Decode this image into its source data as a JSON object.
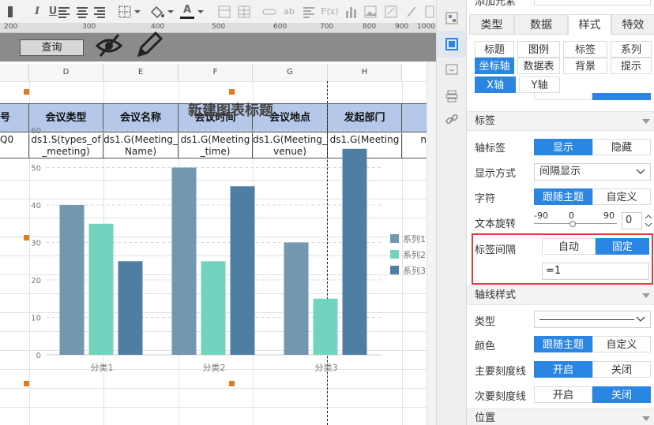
{
  "toolbar": {
    "italic": "I",
    "underline": "U",
    "font_color": "A",
    "fx": "F(x)",
    "ab": "ab"
  },
  "ruler": {
    "ticks": [
      "200",
      "300",
      "400",
      "500",
      "600",
      "700",
      "800",
      "900",
      "1000"
    ]
  },
  "mode_bar": {
    "query_label": "查询"
  },
  "sheet": {
    "columns": [
      "D",
      "E",
      "F",
      "G",
      "H"
    ],
    "header_partial_left": "号",
    "headers": [
      "会议类型",
      "会议名称",
      "会议时间",
      "会议地点",
      "发起部门"
    ],
    "data_partial_left": "Q0",
    "data_cells": [
      "ds1.S(types_of_meeting)",
      "ds1.G(Meeting_Name)",
      "ds1.G(Meeting_time)",
      "ds1.G(Meeting_venue)",
      "ds1.G(Meeting"
    ],
    "data_partial_right": "n"
  },
  "chart_data": {
    "type": "bar",
    "title": "新建图表标题",
    "categories": [
      "分类1",
      "分类2",
      "分类3"
    ],
    "series": [
      {
        "name": "系列1",
        "values": [
          40,
          50,
          30
        ],
        "color": "#7397b0"
      },
      {
        "name": "系列2",
        "values": [
          35,
          25,
          15
        ],
        "color": "#72d4be"
      },
      {
        "name": "系列3",
        "values": [
          25,
          45,
          55
        ],
        "color": "#4e7fa3"
      }
    ],
    "ylim": [
      0,
      60
    ],
    "yticks": [
      "0",
      "10",
      "20",
      "30",
      "40",
      "50",
      "60"
    ],
    "grid": true,
    "legend_position": "right"
  },
  "panel": {
    "top_partial": "添加元素",
    "tabs": [
      "类型",
      "数据",
      "样式",
      "特效"
    ],
    "active_tab": "样式",
    "subtabs_row1": [
      "标题",
      "图例",
      "标签",
      "系列"
    ],
    "subtabs_row2": [
      "坐标轴",
      "数据表",
      "背景",
      "提示"
    ],
    "axis_tabs": [
      "X轴",
      "Y轴"
    ],
    "section_label": "标签",
    "axis_label": "轴标签",
    "axis_label_options": [
      "显示",
      "隐藏"
    ],
    "display_mode_label": "显示方式",
    "display_mode_value": "间隔显示",
    "font_label": "字符",
    "font_options": [
      "跟随主题",
      "自定义"
    ],
    "rotation_label": "文本旋转",
    "rotation_marks": [
      "-90",
      "0",
      "90"
    ],
    "rotation_value": "0",
    "interval_label": "标签间隔",
    "interval_options": [
      "自动",
      "固定"
    ],
    "interval_value": "=1",
    "axis_line_section": "轴线样式",
    "line_type_label": "类型",
    "color_label": "颜色",
    "color_options": [
      "跟随主题",
      "自定义"
    ],
    "major_tick_label": "主要刻度线",
    "major_tick_options": [
      "开启",
      "关闭"
    ],
    "minor_tick_label": "次要刻度线",
    "minor_tick_options": [
      "开启",
      "关闭"
    ],
    "position_section": "位置",
    "accent_color": "#2a86e2",
    "highlight_color": "#e0393e"
  }
}
